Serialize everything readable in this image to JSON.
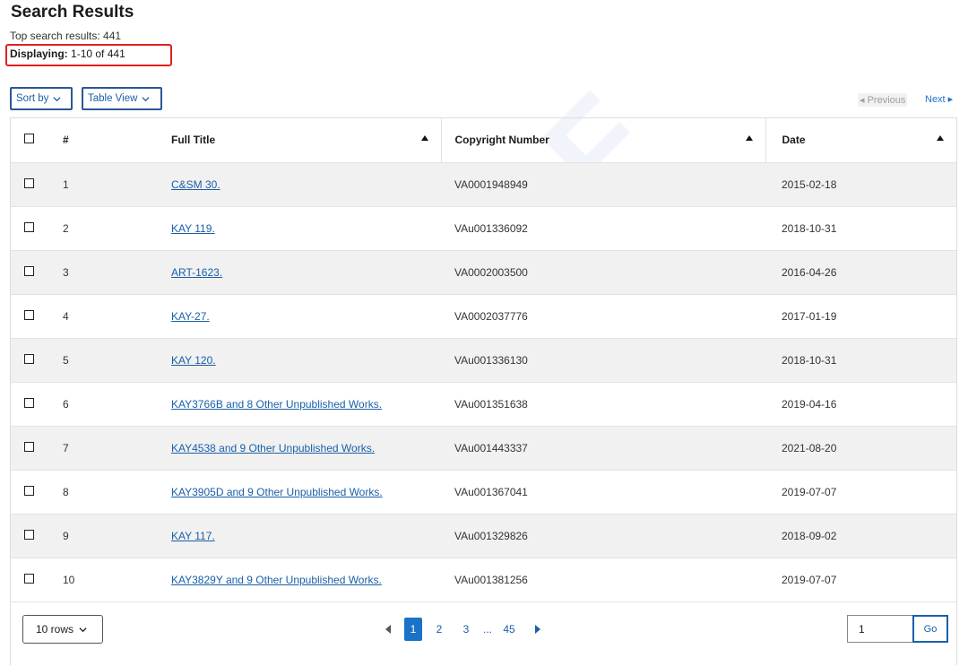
{
  "page": {
    "title": "Search Results",
    "top_results": "Top search results: 441",
    "displaying_label": "Displaying:",
    "displaying_value": "1-10 of 441"
  },
  "toolbar": {
    "sort_label": "Sort by",
    "view_label": "Table View",
    "previous_label": "◂ Previous",
    "next_label": "Next ▸"
  },
  "table": {
    "headers": {
      "num": "#",
      "title": "Full Title",
      "copyright": "Copyright Number",
      "date": "Date"
    },
    "rows": [
      {
        "num": "1",
        "title": "C&SM 30.",
        "copyright": "VA0001948949",
        "date": "2015-02-18"
      },
      {
        "num": "2",
        "title": "KAY 119.",
        "copyright": "VAu001336092",
        "date": "2018-10-31"
      },
      {
        "num": "3",
        "title": "ART-1623.",
        "copyright": "VA0002003500",
        "date": "2016-04-26"
      },
      {
        "num": "4",
        "title": "KAY-27.",
        "copyright": "VA0002037776",
        "date": "2017-01-19"
      },
      {
        "num": "5",
        "title": "KAY 120.",
        "copyright": "VAu001336130",
        "date": "2018-10-31"
      },
      {
        "num": "6",
        "title": "KAY3766B and 8 Other Unpublished Works.",
        "copyright": "VAu001351638",
        "date": "2019-04-16"
      },
      {
        "num": "7",
        "title": "KAY4538 and 9 Other Unpublished Works.",
        "copyright": "VAu001443337",
        "date": "2021-08-20"
      },
      {
        "num": "8",
        "title": "KAY3905D and 9 Other Unpublished Works.",
        "copyright": "VAu001367041",
        "date": "2019-07-07"
      },
      {
        "num": "9",
        "title": "KAY 117.",
        "copyright": "VAu001329826",
        "date": "2018-09-02"
      },
      {
        "num": "10",
        "title": "KAY3829Y and 9 Other Unpublished Works.",
        "copyright": "VAu001381256",
        "date": "2019-07-07"
      }
    ]
  },
  "footer": {
    "rows_label": "10 rows",
    "pages": [
      "1",
      "2",
      "3"
    ],
    "ellipsis": "...",
    "last_page": "45",
    "current_page": "1",
    "goto_value": "1",
    "go_label": "Go"
  },
  "watermark": "123RF",
  "colors": {
    "link": "#1a5fa8",
    "accent": "#1a73c8",
    "highlight_border": "#e02020"
  },
  "icons": [
    "chevron-down-icon",
    "checkbox-icon",
    "sort-ascending-icon",
    "previous-arrow-icon",
    "next-arrow-icon"
  ]
}
